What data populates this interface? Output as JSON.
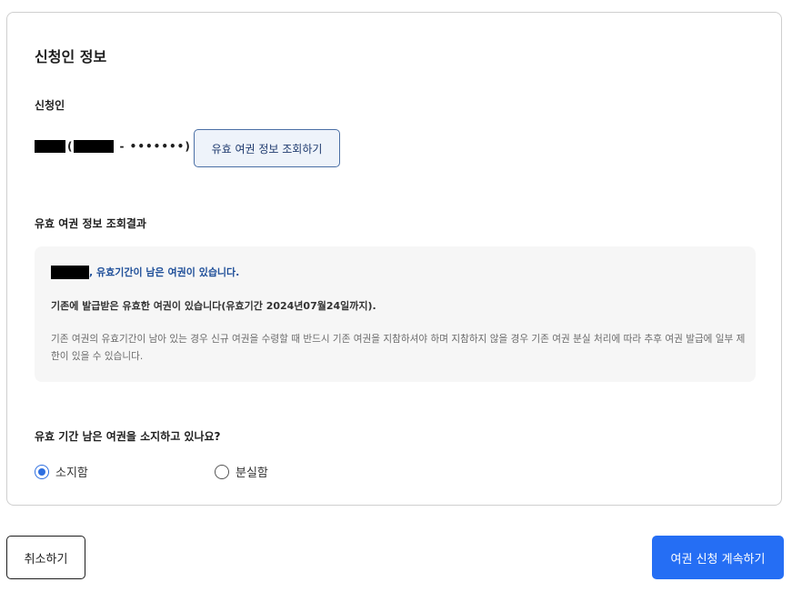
{
  "card": {
    "title": "신청인 정보",
    "applicant_label": "신청인",
    "applicant": {
      "open_paren": "(",
      "rrn_masked": "- •••••••)"
    },
    "lookup_button": "유효 여권 정보 조회하기",
    "result_label": "유효 여권 정보 조회결과",
    "result": {
      "headline": ", 유효기간이 남은 여권이 있습니다.",
      "sub": "기존에 발급받은 유효한 여권이 있습니다(유효기간 2024년07월24일까지).",
      "desc": "기존 여권의 유효기간이 남아 있는 경우 신규 여권을 수령할 때 반드시 기존 여권을 지참하셔야 하며 지참하지 않을 경우 기존 여권 분실 처리에 따라 추후 여권 발급에 일부 제한이 있을 수 있습니다."
    },
    "question": "유효 기간 남은 여권을 소지하고 있나요?",
    "options": [
      {
        "label": "소지함",
        "selected": true
      },
      {
        "label": "분실함",
        "selected": false
      }
    ]
  },
  "footer": {
    "cancel": "취소하기",
    "continue": "여권 신청 계속하기"
  },
  "colors": {
    "primary": "#256ef4",
    "result_headline": "#1f4f99",
    "result_bg": "#f6f6f6"
  }
}
